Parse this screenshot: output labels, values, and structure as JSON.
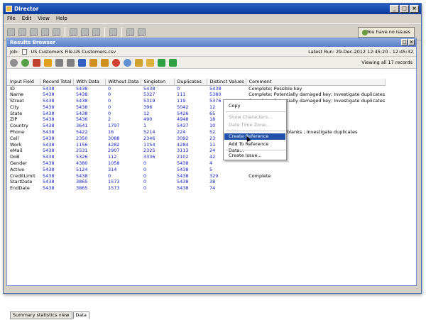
{
  "window": {
    "title": "Director"
  },
  "menu": [
    "File",
    "Edit",
    "View",
    "Help"
  ],
  "issues_button": "You have no issues",
  "panel": {
    "title": "Results Browser"
  },
  "job": {
    "label": "Job:",
    "value": "US Customers File.US Customers.csv",
    "latest_run": "Latest Run:  29-Dec-2012 12:45:20 - 12:45:32"
  },
  "viewing": "Viewing all 17 records",
  "table": {
    "columns": [
      "Input Field",
      "Record Total",
      "With Data",
      "Without Data",
      "Singleton",
      "Duplicates",
      "Distinct Values",
      "Comment"
    ],
    "rows": [
      [
        "ID",
        "5438",
        "5438",
        "0",
        "5438",
        "0",
        "5438",
        "Complete; Possible key"
      ],
      [
        "Name",
        "5438",
        "5438",
        "0",
        "5327",
        "111",
        "5380",
        "Complete; Potentially damaged key; Investigate duplicates"
      ],
      [
        "Street",
        "5438",
        "5438",
        "0",
        "5319",
        "119",
        "5376",
        "Complete; Potentially damaged key; Investigate duplicates"
      ],
      [
        "City",
        "5438",
        "5438",
        "0",
        "396",
        "5042",
        "12",
        ""
      ],
      [
        "State",
        "5438",
        "5438",
        "0",
        "12",
        "5426",
        "65",
        ""
      ],
      [
        "ZIP",
        "5438",
        "5436",
        "2",
        "490",
        "4948",
        "18",
        ""
      ],
      [
        "Country",
        "5438",
        "3641",
        "1797",
        "1",
        "5437",
        "10",
        ""
      ],
      [
        "Phone",
        "5438",
        "5422",
        "16",
        "5214",
        "224",
        "52",
        "key; Investigate blanks ; Investigate duplicates"
      ],
      [
        "Cell",
        "5438",
        "2350",
        "3088",
        "2346",
        "3092",
        "23",
        ""
      ],
      [
        "Work",
        "5438",
        "1156",
        "4282",
        "1154",
        "4284",
        "11",
        ""
      ],
      [
        "eMail",
        "5438",
        "2531",
        "2907",
        "2325",
        "3113",
        "24",
        ""
      ],
      [
        "DoB",
        "5438",
        "5326",
        "112",
        "3336",
        "2102",
        "42",
        ""
      ],
      [
        "Gender",
        "5438",
        "4380",
        "1058",
        "0",
        "5438",
        "4",
        ""
      ],
      [
        "Active",
        "5438",
        "5124",
        "314",
        "0",
        "5438",
        "5",
        ""
      ],
      [
        "CreditLimit",
        "5438",
        "5438",
        "0",
        "0",
        "5438",
        "329",
        "Complete"
      ],
      [
        "StartDate",
        "5438",
        "3865",
        "1573",
        "0",
        "5438",
        "38",
        ""
      ],
      [
        "EndDate",
        "5438",
        "3865",
        "1573",
        "0",
        "5438",
        "74",
        ""
      ]
    ]
  },
  "context_menu": [
    "Copy",
    "Show Characters...",
    "Date Time Zone...",
    "Create Reference Data...",
    "Add To Reference Data...",
    "Create Issue..."
  ],
  "bottom_tabs": [
    "Summary statistics view",
    "Data"
  ]
}
